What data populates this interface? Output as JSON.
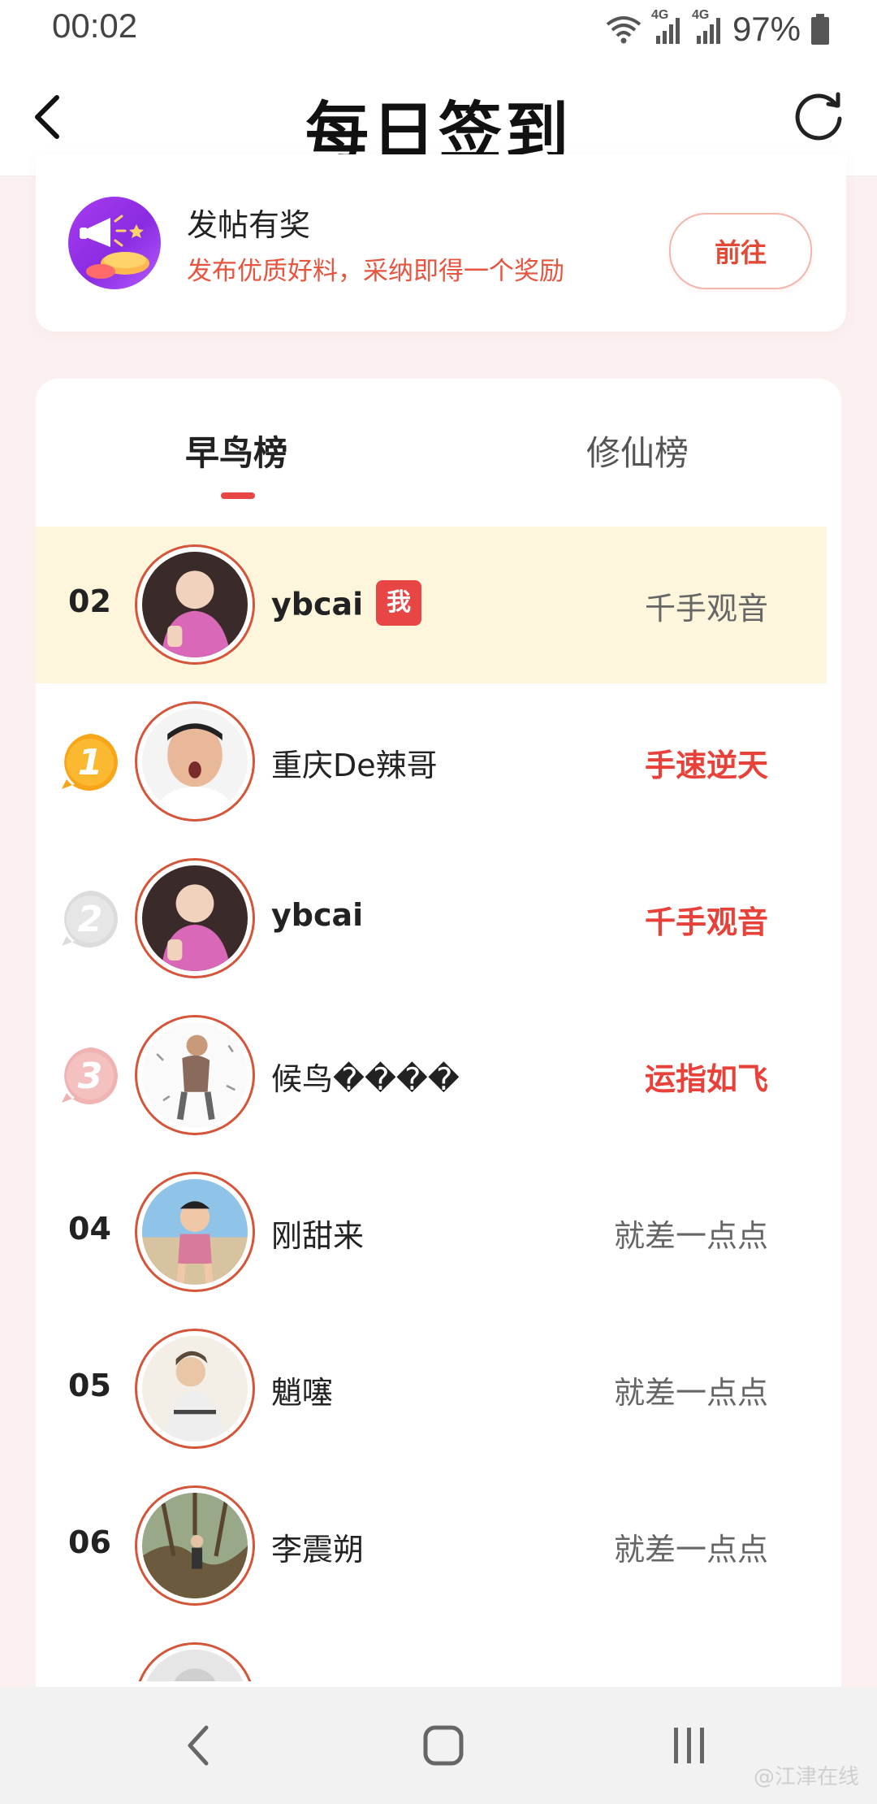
{
  "status_bar": {
    "time": "00:02",
    "battery": "97%",
    "network_1": "4G",
    "network_2": "4G"
  },
  "header": {
    "title": "每日签到"
  },
  "promo": {
    "title": "发帖有奖",
    "subtitle": "发布优质好料，采纳即得一个奖励",
    "button_label": "前往"
  },
  "tabs": [
    {
      "label": "早鸟榜",
      "active": true
    },
    {
      "label": "修仙榜",
      "active": false
    }
  ],
  "my_rank": {
    "rank": "02",
    "name": "ybcai",
    "me_badge": "我",
    "title": "千手观音"
  },
  "ranking": [
    {
      "medal": "1",
      "name": "重庆De辣哥",
      "title": "手速逆天"
    },
    {
      "medal": "2",
      "name": "ybcai",
      "title": "千手观音"
    },
    {
      "medal": "3",
      "name": "候鸟����",
      "title": "运指如飞"
    },
    {
      "rank": "04",
      "name": "刚甜来",
      "title": "就差一点点"
    },
    {
      "rank": "05",
      "name": "魈噻",
      "title": "就差一点点"
    },
    {
      "rank": "06",
      "name": "李震朔",
      "title": "就差一点点"
    }
  ],
  "watermark": "@江津在线",
  "colors": {
    "accent": "#e84545",
    "promo_text": "#e5553f",
    "highlight_row": "#fdf5dc",
    "page_bg": "#fbf1f1"
  }
}
